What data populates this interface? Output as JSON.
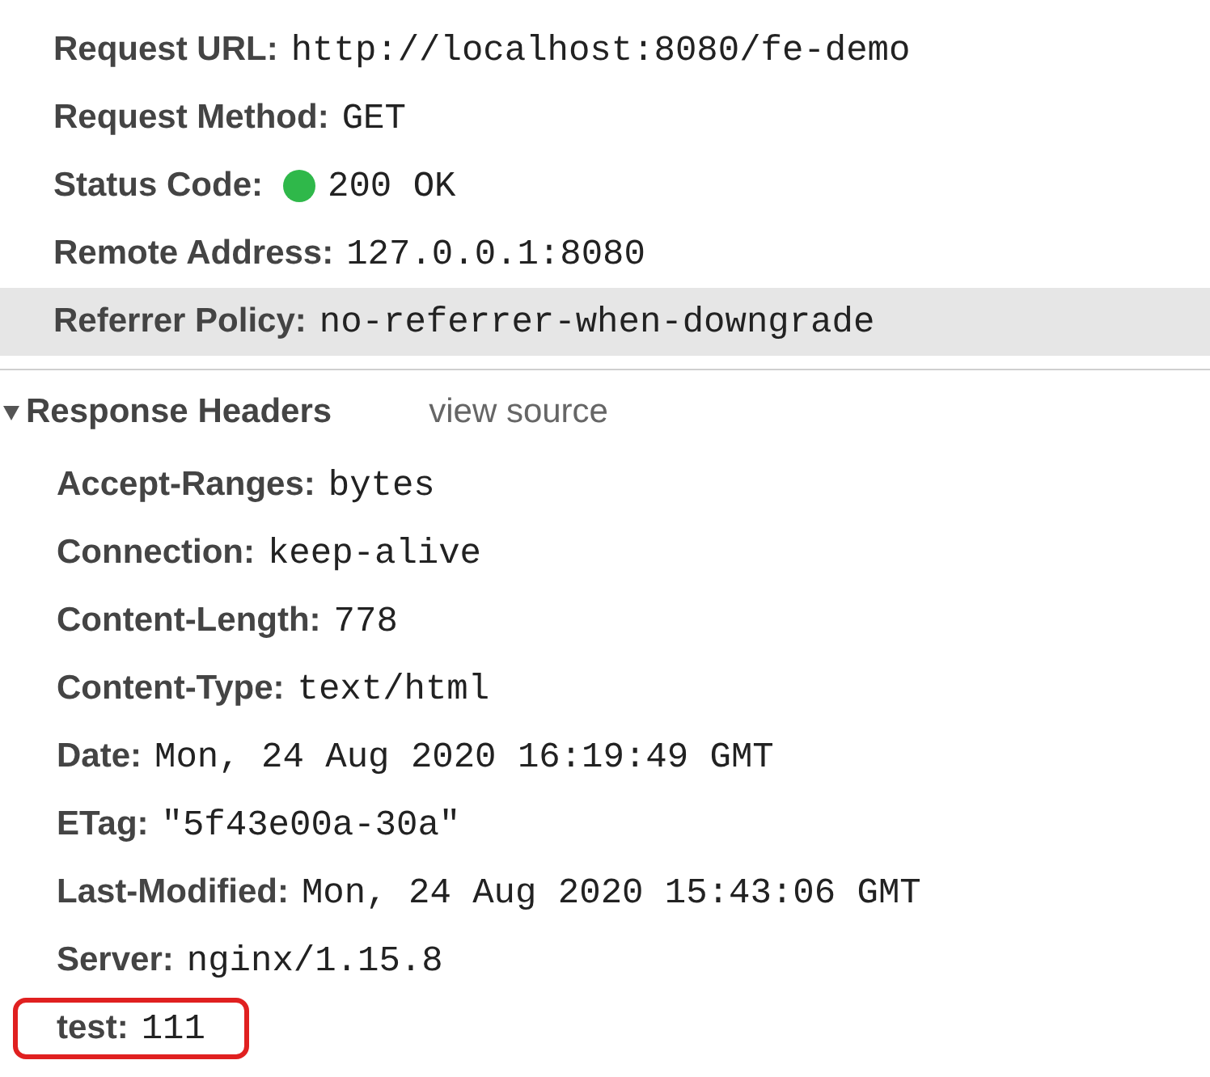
{
  "general": [
    {
      "kind": "text",
      "name": "Request URL:",
      "value": "http://localhost:8080/fe-demo",
      "selected": false
    },
    {
      "kind": "text",
      "name": "Request Method:",
      "value": "GET",
      "selected": false
    },
    {
      "kind": "status",
      "name": "Status Code:",
      "value": "200 OK",
      "color": "#2fb84a",
      "selected": false
    },
    {
      "kind": "text",
      "name": "Remote Address:",
      "value": "127.0.0.1:8080",
      "selected": false
    },
    {
      "kind": "text",
      "name": "Referrer Policy:",
      "value": "no-referrer-when-downgrade",
      "selected": true
    }
  ],
  "response_headers": {
    "title": "Response Headers",
    "expanded": true,
    "link": "view source",
    "rows": [
      {
        "name": "Accept-Ranges:",
        "value": "bytes",
        "highlighted": false
      },
      {
        "name": "Connection:",
        "value": "keep-alive",
        "highlighted": false
      },
      {
        "name": "Content-Length:",
        "value": "778",
        "highlighted": false
      },
      {
        "name": "Content-Type:",
        "value": "text/html",
        "highlighted": false
      },
      {
        "name": "Date:",
        "value": "Mon, 24 Aug 2020 16:19:49 GMT",
        "highlighted": false
      },
      {
        "name": "ETag:",
        "value": "\"5f43e00a-30a\"",
        "highlighted": false
      },
      {
        "name": "Last-Modified:",
        "value": "Mon, 24 Aug 2020 15:43:06 GMT",
        "highlighted": false
      },
      {
        "name": "Server:",
        "value": "nginx/1.15.8",
        "highlighted": false
      },
      {
        "name": "test:",
        "value": "111",
        "highlighted": true
      }
    ]
  }
}
